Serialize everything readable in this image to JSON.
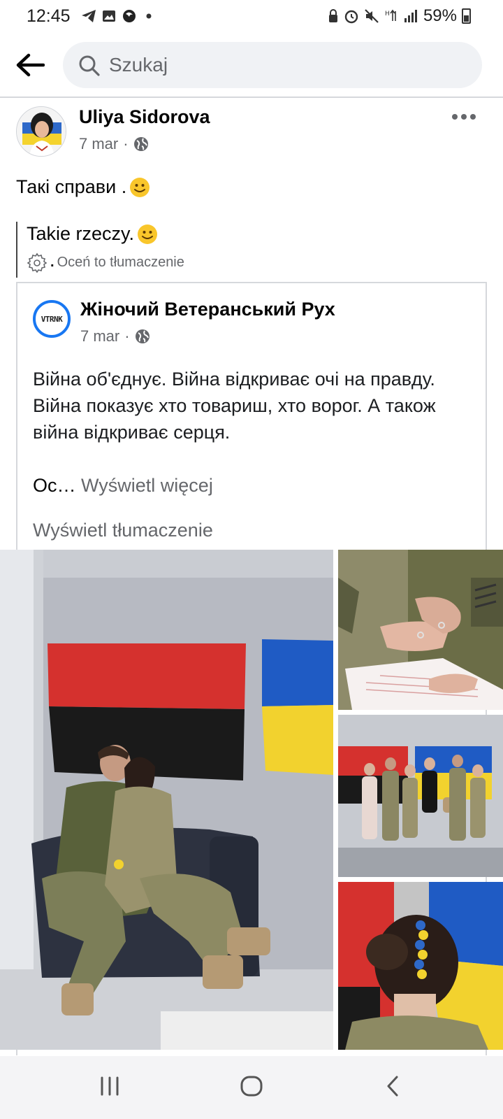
{
  "status_bar": {
    "time": "12:45",
    "battery": "59%",
    "left_icons": [
      "telegram-icon",
      "gallery-icon",
      "app-icon",
      "dot-icon"
    ],
    "right_icons": [
      "lock-icon",
      "alarm-icon",
      "mute-icon",
      "data-icon",
      "signal-icon",
      "battery-icon"
    ]
  },
  "search": {
    "placeholder": "Szukaj"
  },
  "post": {
    "author": "Uliya Sidorova",
    "date": "7 mar",
    "separator": "·",
    "text": "Такі справи .",
    "translation": {
      "text": "Takie rzeczy.",
      "rate_label": "Oceń to tłumaczenie",
      "rate_prefix": "."
    }
  },
  "shared": {
    "avatar_text": "VTRNK",
    "author": "Жіночий Ветеранський Рух",
    "date": "7 mar",
    "separator": "·",
    "body": "Війна об'єднує. Війна відкриває очі на правду. Війна показує хто товариш, хто ворог. А також війна відкриває серця.",
    "truncated": "Ос…",
    "see_more": "Wyświetl więcej",
    "see_translation": "Wyświetl tłumaczenie"
  },
  "colors": {
    "accent": "#1877f2",
    "secondary_text": "#65676b",
    "search_bg": "#f0f2f5",
    "flag_red": "#d5312e",
    "flag_black": "#1a1a1a",
    "flag_blue": "#1f5bc4",
    "flag_yellow": "#f2d22e"
  },
  "nav": [
    "recent-apps-icon",
    "home-icon",
    "back-icon"
  ]
}
